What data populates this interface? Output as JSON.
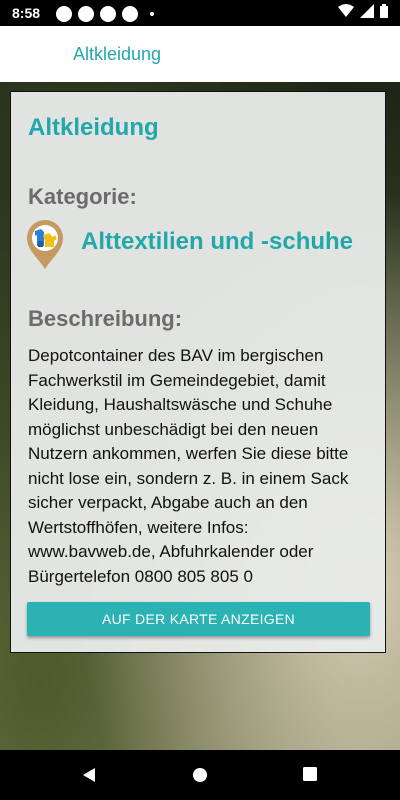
{
  "status_bar": {
    "time": "8:58"
  },
  "app_bar": {
    "title": "Altkleidung"
  },
  "card": {
    "title": "Altkleidung",
    "category_label": "Kategorie:",
    "category_name": "Alttextilien und -schuhe",
    "category_icon": "clothing-pin-icon",
    "description_label": "Beschreibung:",
    "description": "Depotcontainer des BAV im bergischen Fachwerkstil im Gemeindegebiet, damit Kleidung, Haushaltswäsche und Schuhe möglichst unbeschädigt bei den neuen Nutzern ankommen, werfen Sie diese bitte nicht lose ein, sondern z. B. in einem Sack sicher verpackt, Abgabe auch an den Wertstoffhöfen, weitere Infos: www.bavweb.de, Abfuhrkalender oder Bürgertelefon 0800 805 805 0",
    "map_button_label": "AUF DER KARTE ANZEIGEN"
  },
  "colors": {
    "accent": "#22a8ab",
    "button": "#2bb3b3",
    "label_gray": "#6b6b6b"
  },
  "nav_bar": {
    "icons": [
      "back-icon",
      "home-icon",
      "recents-icon"
    ]
  }
}
